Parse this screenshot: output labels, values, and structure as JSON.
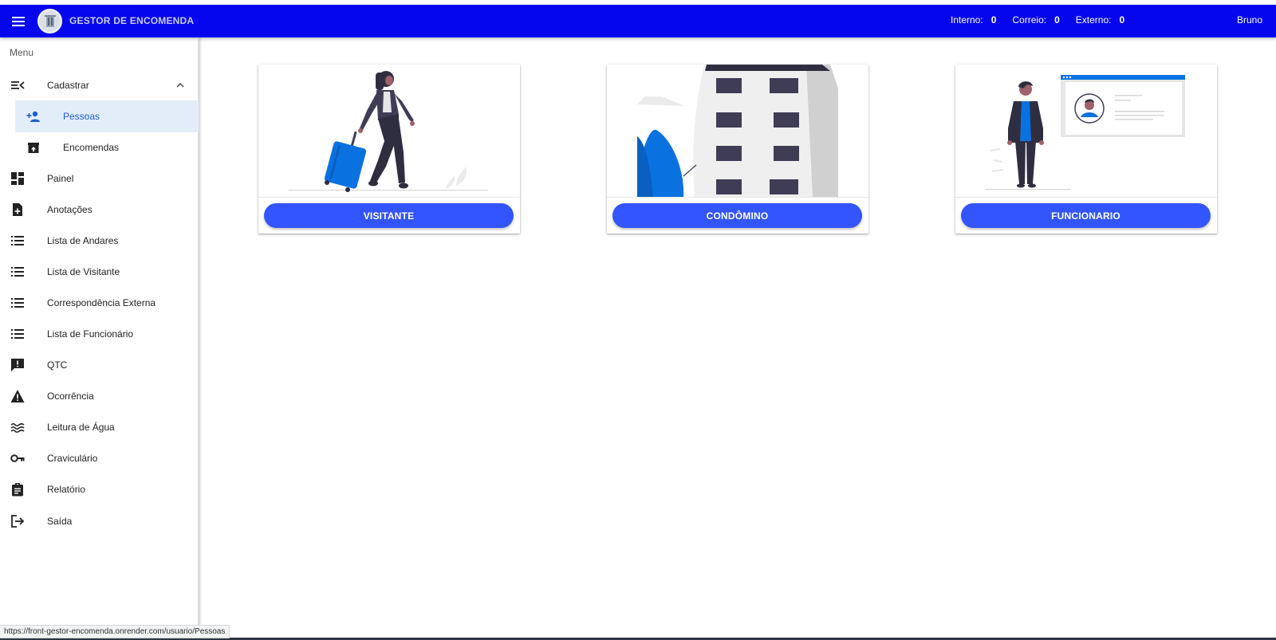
{
  "header": {
    "app_title": "GESTOR DE ENCOMENDA",
    "counters": [
      {
        "label": "Interno:",
        "value": "0"
      },
      {
        "label": "Correio:",
        "value": "0"
      },
      {
        "label": "Externo:",
        "value": "0"
      }
    ],
    "user": "Bruno",
    "bar_color": "#0505ee"
  },
  "sidebar": {
    "heading": "Menu",
    "items": [
      {
        "label": "Cadastrar",
        "icon": "playlist-add-icon"
      },
      {
        "label": "Pessoas",
        "icon": "person-add-icon"
      },
      {
        "label": "Encomendas",
        "icon": "archive-icon"
      },
      {
        "label": "Painel",
        "icon": "dashboard-icon"
      },
      {
        "label": "Anotações",
        "icon": "note-add-icon"
      },
      {
        "label": "Lista de Andares",
        "icon": "list-icon"
      },
      {
        "label": "Lista de Visitante",
        "icon": "list-icon"
      },
      {
        "label": "Correspondência Externa",
        "icon": "list-icon"
      },
      {
        "label": "Lista de Funcionário",
        "icon": "list-icon"
      },
      {
        "label": "QTC",
        "icon": "feedback-icon"
      },
      {
        "label": "Ocorrência",
        "icon": "warning-icon"
      },
      {
        "label": "Leitura de Água",
        "icon": "waves-icon"
      },
      {
        "label": "Craviculário",
        "icon": "key-icon"
      },
      {
        "label": "Relatório",
        "icon": "assignment-icon"
      },
      {
        "label": "Saída",
        "icon": "logout-icon"
      }
    ],
    "active_item": "Pessoas"
  },
  "cards": [
    {
      "button_label": "VISITANTE"
    },
    {
      "button_label": "CONDÔMINO"
    },
    {
      "button_label": "FUNCIONARIO"
    }
  ],
  "accent_color": "#3355ff",
  "status_url": "https://front-gestor-encomenda.onrender.com/usuario/Pessoas"
}
